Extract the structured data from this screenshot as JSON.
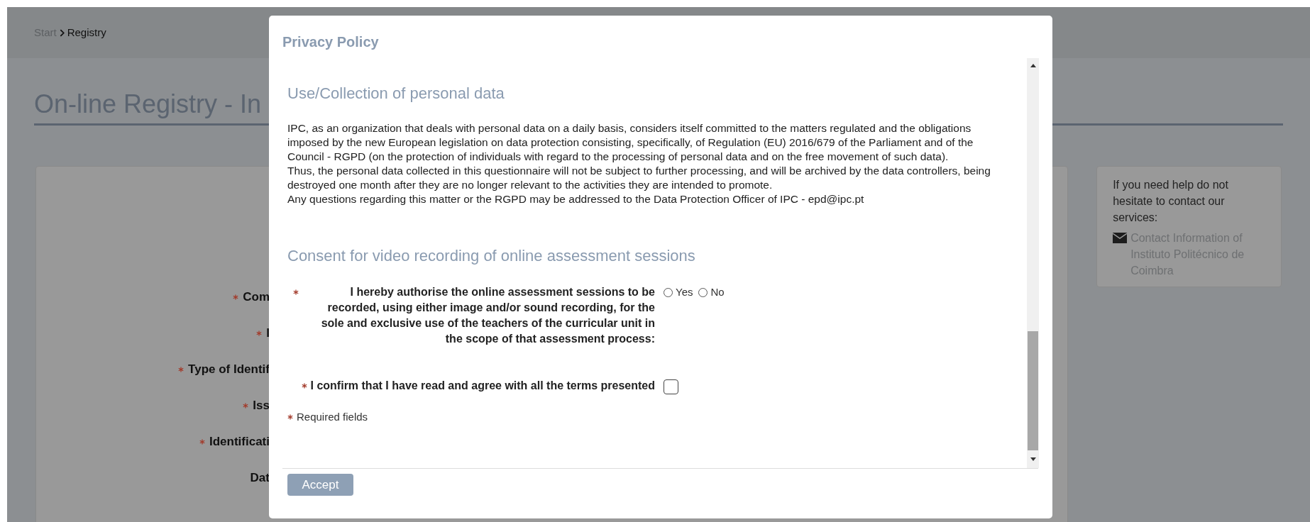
{
  "breadcrumb": {
    "items": [
      {
        "label": "Start",
        "current": false
      },
      {
        "label": "Registry",
        "current": true
      }
    ]
  },
  "page_title": "On-line Registry - In",
  "form_labels": [
    {
      "text": "Com",
      "required": true
    },
    {
      "text": "I",
      "required": true
    },
    {
      "text": "Type of Identif",
      "required": true
    },
    {
      "text": "Iss",
      "required": true
    },
    {
      "text": "Identificati",
      "required": true
    },
    {
      "text": "Dat",
      "required": false
    }
  ],
  "help_box": {
    "text": "If you need help do not hesitate to contact our services:",
    "link": "Contact Information of Instituto Politécnico de Coimbra"
  },
  "modal": {
    "title": "Privacy Policy",
    "sections": [
      {
        "heading": "Use/Collection of personal data",
        "paragraphs": [
          "IPC, as an organization that deals with personal data on a daily basis, considers itself committed to the matters regulated and the obligations imposed by the new European legislation on data protection consisting, specifically, of Regulation (EU) 2016/679 of the Parliament and of the Council - RGPD (on the protection of individuals with regard to the processing of personal data and on the free movement of such data).",
          "Thus, the personal data collected in this questionnaire will not be subject to further processing, and will be archived by the data controllers, being destroyed one month after they are no longer relevant to the activities they are intended to promote.",
          "Any questions regarding this matter or the RGPD may be addressed to the Data Protection Officer of IPC - epd@ipc.pt"
        ]
      },
      {
        "heading": "Consent for video recording of online assessment sessions",
        "questions": [
          {
            "kind": "radio",
            "required": true,
            "label": "I hereby authorise the online assessment sessions to be recorded, using either image and/or sound recording, for the sole and exclusive use of the teachers of the curricular unit in the scope of that assessment process:",
            "options": [
              {
                "label": "Yes",
                "selected": false
              },
              {
                "label": "No",
                "selected": false
              }
            ]
          },
          {
            "kind": "checkbox",
            "required": true,
            "label": "I confirm that I have read and agree with all the terms presented",
            "checked": false
          }
        ]
      }
    ],
    "required_note": "Required fields",
    "accept_button": "Accept"
  }
}
